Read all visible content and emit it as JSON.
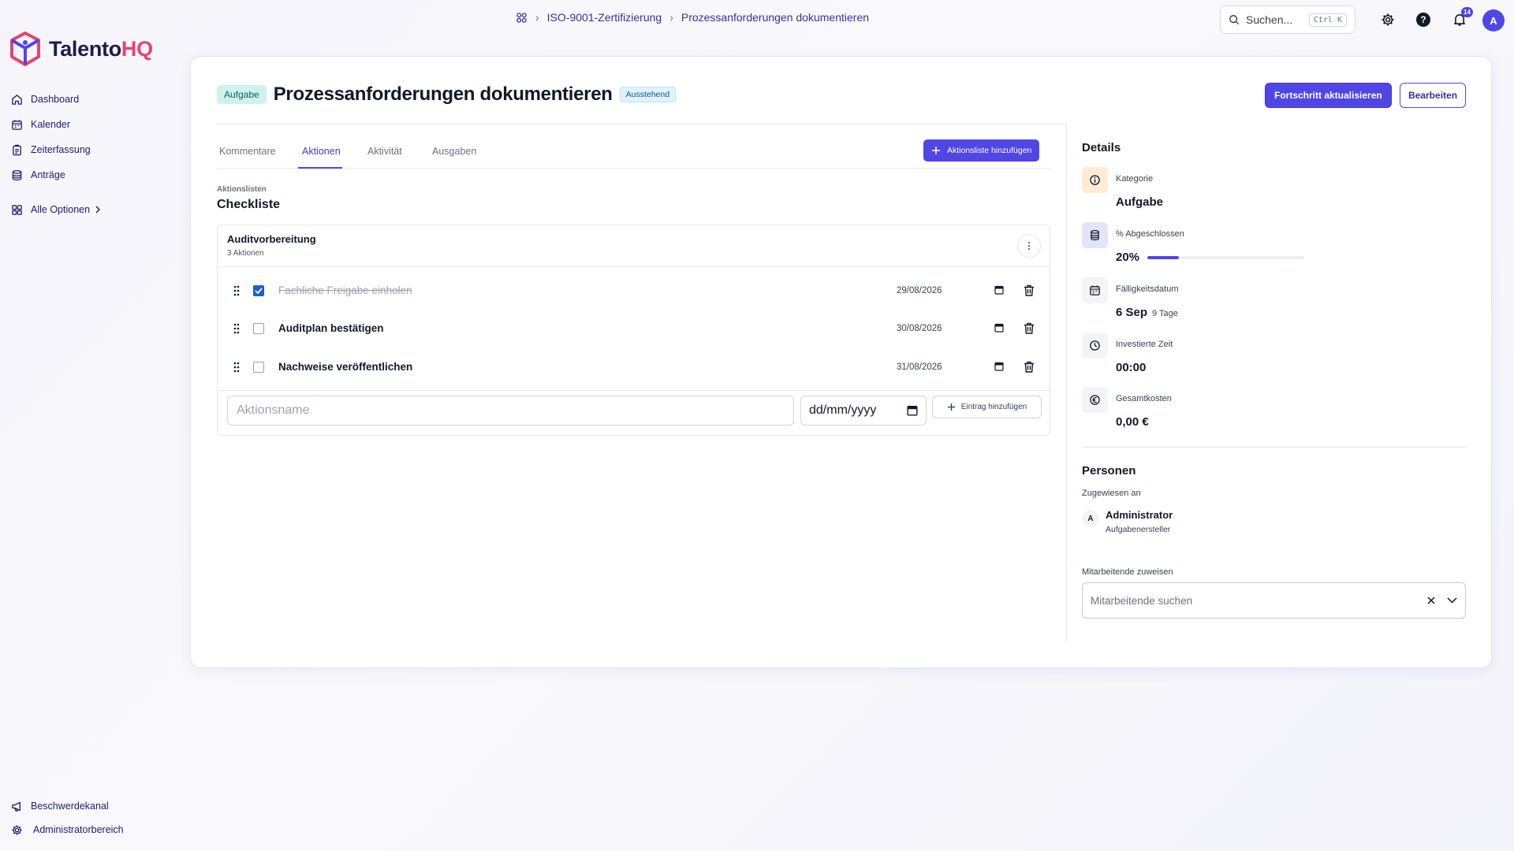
{
  "app": {
    "name_part1": "Talento",
    "name_part2": "HQ",
    "brand_color": "#4f46e5",
    "accent_color": "#e8436b"
  },
  "sidebar": {
    "items": [
      {
        "label": "Dashboard",
        "icon": "home-icon"
      },
      {
        "label": "Kalender",
        "icon": "calendar-icon"
      },
      {
        "label": "Zeiterfassung",
        "icon": "clipboard-icon"
      },
      {
        "label": "Anträge",
        "icon": "database-icon"
      }
    ],
    "more_label": "Alle Optionen",
    "bottom": [
      {
        "label": "Beschwerdekanal",
        "icon": "megaphone-icon"
      },
      {
        "label": "Administratorbereich",
        "icon": "gear-icon"
      }
    ]
  },
  "topbar": {
    "breadcrumb": [
      "ISO-9001-Zertifizierung",
      "Prozessanforderungen dokumentieren"
    ],
    "search_placeholder": "Suchen...",
    "search_shortcut": "Ctrl K",
    "notification_count": "14",
    "avatar_initial": "A"
  },
  "task": {
    "type_badge": "Aufgabe",
    "title": "Prozessanforderungen dokumentieren",
    "status": "Ausstehend",
    "update_button": "Fortschritt aktualisieren",
    "edit_button": "Bearbeiten"
  },
  "tabs": [
    {
      "label": "Kommentare",
      "active": false
    },
    {
      "label": "Aktionen",
      "active": true
    },
    {
      "label": "Aktivität",
      "active": false
    },
    {
      "label": "Ausgaben",
      "active": false
    }
  ],
  "actions": {
    "add_list_button": "Aktionsliste hinzufügen",
    "section_sub": "Aktionslisten",
    "section_title": "Checkliste",
    "list": {
      "name": "Auditvorbereitung",
      "count": "3 Aktionen",
      "items": [
        {
          "label": "Fachliche Freigabe einholen",
          "date": "29/08/2026",
          "done": true
        },
        {
          "label": "Auditplan bestätigen",
          "date": "30/08/2026",
          "done": false
        },
        {
          "label": "Nachweise veröffentlichen",
          "date": "31/08/2026",
          "done": false
        }
      ]
    },
    "new_item": {
      "name_placeholder": "Aktionsname",
      "date_placeholder": "dd/mm/yyyy",
      "add_button": "Eintrag hinzufügen"
    }
  },
  "details": {
    "title": "Details",
    "category": {
      "label": "Kategorie",
      "value": "Aufgabe"
    },
    "completion": {
      "label": "% Abgeschlossen",
      "value": "20%",
      "percent": 20
    },
    "due": {
      "label": "Fälligkeitsdatum",
      "value": "6 Sep",
      "extra": "9 Tage"
    },
    "time": {
      "label": "Investierte Zeit",
      "value": "00:00"
    },
    "cost": {
      "label": "Gesamtkosten",
      "value": "0,00 €"
    }
  },
  "people": {
    "title": "Personen",
    "assigned_label": "Zugewiesen an",
    "assignee": {
      "initial": "A",
      "name": "Administrator",
      "role": "Aufgabenersteller"
    },
    "assign_label": "Mitarbeitende zuweisen",
    "assign_placeholder": "Mitarbeitende suchen"
  }
}
